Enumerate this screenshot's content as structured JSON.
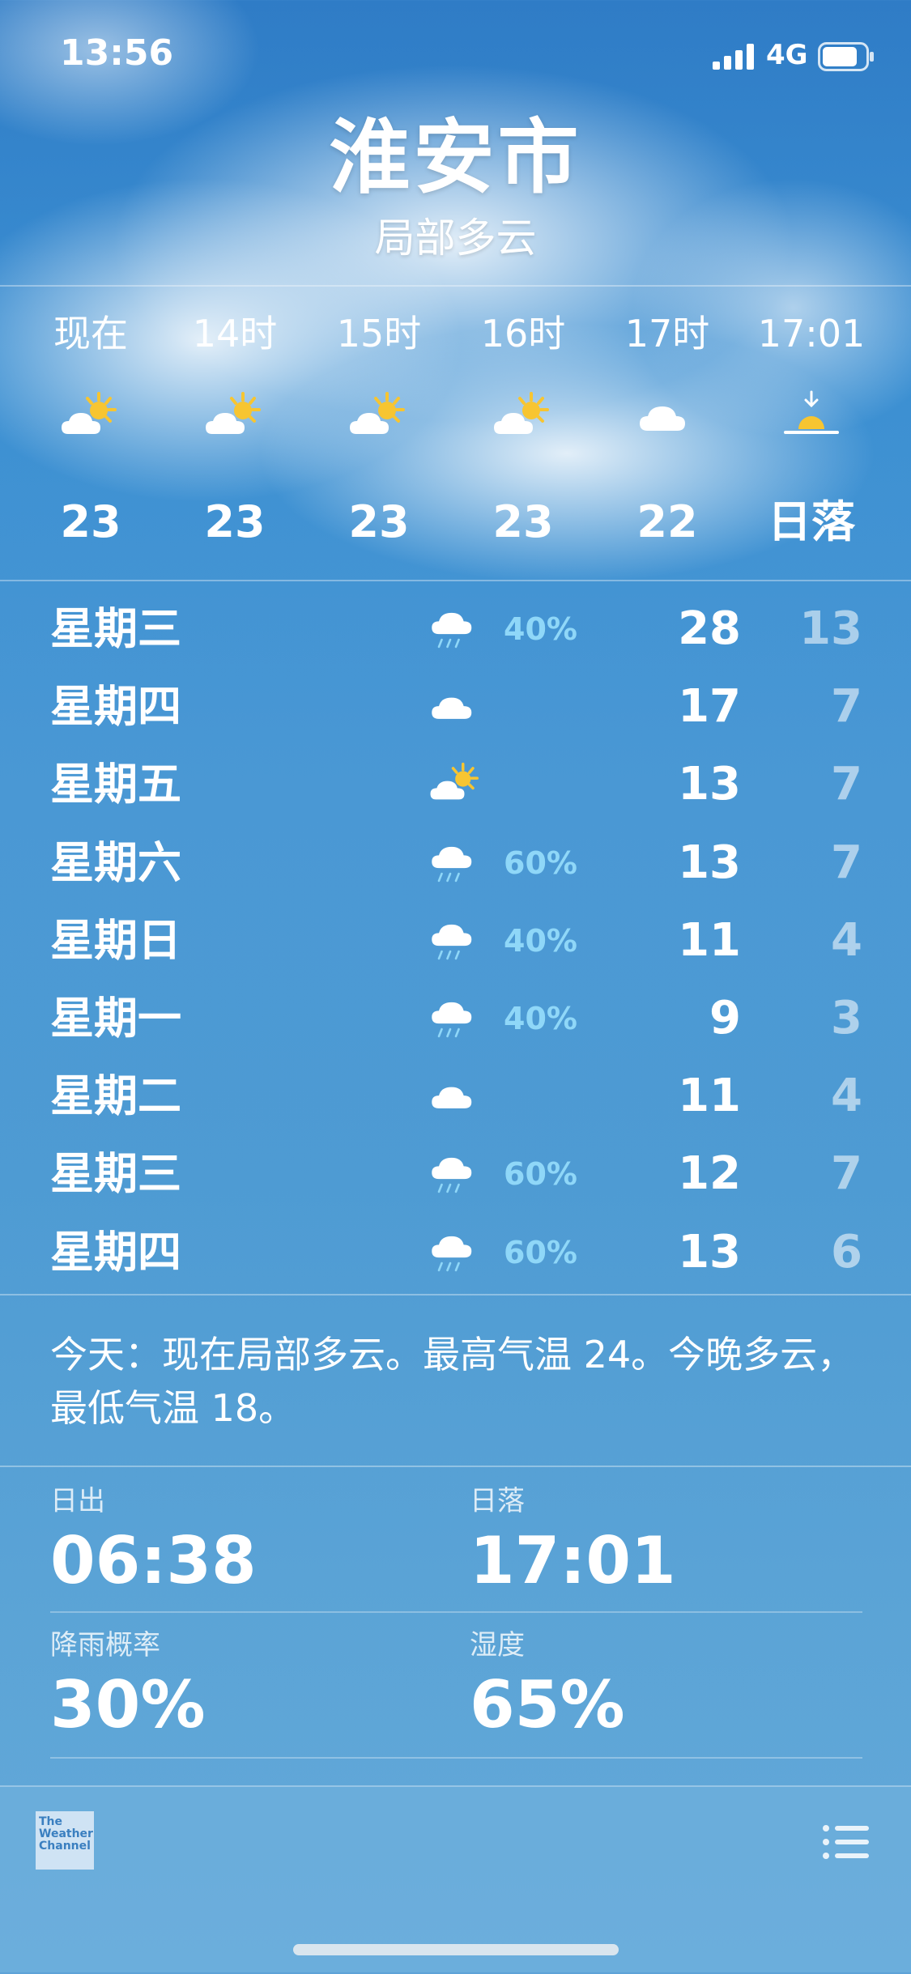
{
  "status": {
    "time": "13:56",
    "network": "4G"
  },
  "header": {
    "city": "淮安市",
    "condition": "局部多云"
  },
  "hourly": [
    {
      "label": "现在",
      "icon": "partly-sunny-icon",
      "temp": "23"
    },
    {
      "label": "14时",
      "icon": "partly-sunny-icon",
      "temp": "23"
    },
    {
      "label": "15时",
      "icon": "partly-sunny-icon",
      "temp": "23"
    },
    {
      "label": "16时",
      "icon": "partly-sunny-icon",
      "temp": "23"
    },
    {
      "label": "17时",
      "icon": "cloud-icon",
      "temp": "22"
    },
    {
      "label": "17:01",
      "icon": "sunset-icon",
      "temp": "日落"
    }
  ],
  "daily": [
    {
      "day": "星期三",
      "icon": "rain-icon",
      "precip": "40%",
      "high": "28",
      "low": "13"
    },
    {
      "day": "星期四",
      "icon": "cloud-icon",
      "precip": "",
      "high": "17",
      "low": "7"
    },
    {
      "day": "星期五",
      "icon": "partly-sunny-icon",
      "precip": "",
      "high": "13",
      "low": "7"
    },
    {
      "day": "星期六",
      "icon": "rain-icon",
      "precip": "60%",
      "high": "13",
      "low": "7"
    },
    {
      "day": "星期日",
      "icon": "rain-icon",
      "precip": "40%",
      "high": "11",
      "low": "4"
    },
    {
      "day": "星期一",
      "icon": "rain-icon",
      "precip": "40%",
      "high": "9",
      "low": "3"
    },
    {
      "day": "星期二",
      "icon": "cloud-icon",
      "precip": "",
      "high": "11",
      "low": "4"
    },
    {
      "day": "星期三",
      "icon": "rain-icon",
      "precip": "60%",
      "high": "12",
      "low": "7"
    },
    {
      "day": "星期四",
      "icon": "rain-icon",
      "precip": "60%",
      "high": "13",
      "low": "6"
    }
  ],
  "summary": "今天：现在局部多云。最高气温 24。今晚多云，最低气温 18。",
  "details": {
    "sunrise": {
      "label": "日出",
      "value": "06:38"
    },
    "sunset": {
      "label": "日落",
      "value": "17:01"
    },
    "rain_chance": {
      "label": "降雨概率",
      "value": "30%"
    },
    "humidity": {
      "label": "湿度",
      "value": "65%"
    }
  },
  "footer": {
    "logo_text": "The Weather Channel",
    "logo_lines": [
      "The",
      "Weather",
      "Channel"
    ]
  },
  "colors": {
    "precip": "#8fd7f8",
    "sun": "#f7c531",
    "background": "#4a98d4"
  }
}
